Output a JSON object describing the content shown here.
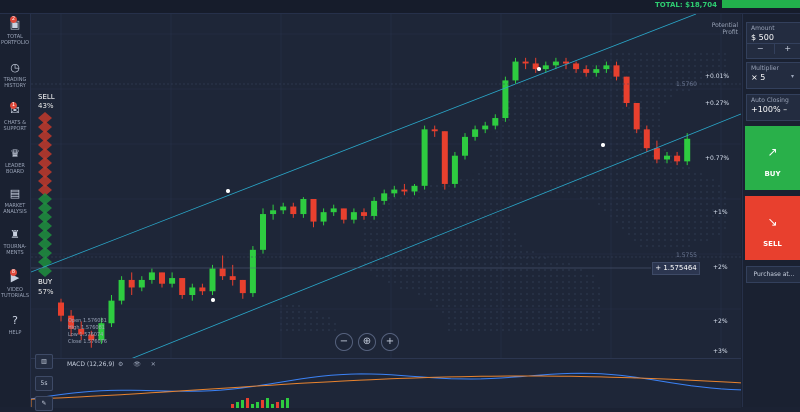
{
  "topbar": {
    "total": "TOTAL: $18,704"
  },
  "sidebar": {
    "items": [
      {
        "label": "TOTAL PORTFOLIO",
        "icon": "briefcase-icon",
        "glyph": "▣",
        "badge": "2"
      },
      {
        "label": "TRADING HISTORY",
        "icon": "history-icon",
        "glyph": "◷"
      },
      {
        "label": "CHATS & SUPPORT",
        "icon": "chat-icon",
        "glyph": "✉",
        "badge": "1"
      },
      {
        "label": "LEADER BOARD",
        "icon": "leaderboard-icon",
        "glyph": "♛"
      },
      {
        "label": "MARKET ANALYSIS",
        "icon": "market-analysis-icon",
        "glyph": "▤"
      },
      {
        "label": "TOURNA-MENTS",
        "icon": "trophy-icon",
        "glyph": "♜"
      },
      {
        "label": "VIDEO TUTORIALS",
        "icon": "video-icon",
        "glyph": "▶",
        "badge": "8"
      },
      {
        "label": "HELP",
        "icon": "help-icon",
        "glyph": "?"
      }
    ]
  },
  "sentiment": {
    "sell_label": "SELL",
    "sell_pct": "43%",
    "buy_label": "BUY",
    "buy_pct": "57%",
    "sell_color": "#c0392b",
    "buy_color": "#1e8f3e"
  },
  "potential_profit": "Potential Profit",
  "scale": {
    "labels": [
      "+0.01%",
      "+0.27%",
      "+0.77%",
      "+1%",
      "+2%",
      "+2%",
      "+3%"
    ],
    "price_upper": "1.5760",
    "price_lower": "1.5755",
    "current_price": "1.575464"
  },
  "ohlc": {
    "open": "Open 1.576081",
    "high": "High 1.576081",
    "low": "Low 1.576074",
    "close": "Close 1.576076"
  },
  "zoom": {
    "minus": "−",
    "center": "⊕",
    "plus": "+"
  },
  "indicator": {
    "label": "MACD (12,26,9)",
    "icons": "⚙ 👁 ✕"
  },
  "timeframe": {
    "chart_type": "▥",
    "interval": "5s",
    "drawing": "✎"
  },
  "right": {
    "amount_title": "Amount",
    "amount_value": "$ 500",
    "step_minus": "−",
    "step_plus": "+",
    "multiplier_title": "Multiplier",
    "multiplier_value": "× 5",
    "autoclose_title": "Auto Closing",
    "autoclose_value": "+100% –",
    "buy_label": "BUY",
    "sell_label": "SELL",
    "purchase_label": "Purchase at..."
  },
  "colors": {
    "up": "#2ecc40",
    "down": "#e8402e",
    "channel": "#2aa7c9",
    "bg": "#1e2638",
    "macd_line": "#3b82f6",
    "signal_line": "#e8832e"
  },
  "chart_data": {
    "type": "candlestick",
    "candles": [
      {
        "o": 1.5757,
        "h": 1.57572,
        "l": 1.5756,
        "c": 1.57563
      },
      {
        "o": 1.57563,
        "h": 1.57566,
        "l": 1.57552,
        "c": 1.57556
      },
      {
        "o": 1.57556,
        "h": 1.5756,
        "l": 1.5755,
        "c": 1.57553
      },
      {
        "o": 1.57553,
        "h": 1.57555,
        "l": 1.57546,
        "c": 1.5755
      },
      {
        "o": 1.5755,
        "h": 1.57562,
        "l": 1.57548,
        "c": 1.57559
      },
      {
        "o": 1.57559,
        "h": 1.57574,
        "l": 1.57557,
        "c": 1.57571
      },
      {
        "o": 1.57571,
        "h": 1.57584,
        "l": 1.57569,
        "c": 1.57582
      },
      {
        "o": 1.57582,
        "h": 1.57586,
        "l": 1.57574,
        "c": 1.57578
      },
      {
        "o": 1.57578,
        "h": 1.57584,
        "l": 1.57576,
        "c": 1.57582
      },
      {
        "o": 1.57582,
        "h": 1.57588,
        "l": 1.5758,
        "c": 1.57586
      },
      {
        "o": 1.57586,
        "h": 1.57586,
        "l": 1.57578,
        "c": 1.5758
      },
      {
        "o": 1.5758,
        "h": 1.57586,
        "l": 1.57578,
        "c": 1.57583
      },
      {
        "o": 1.57583,
        "h": 1.57583,
        "l": 1.57572,
        "c": 1.57574
      },
      {
        "o": 1.57574,
        "h": 1.5758,
        "l": 1.57571,
        "c": 1.57578
      },
      {
        "o": 1.57578,
        "h": 1.5758,
        "l": 1.57574,
        "c": 1.57576
      },
      {
        "o": 1.57576,
        "h": 1.5759,
        "l": 1.57574,
        "c": 1.57588
      },
      {
        "o": 1.57588,
        "h": 1.57595,
        "l": 1.57582,
        "c": 1.57584
      },
      {
        "o": 1.57584,
        "h": 1.5759,
        "l": 1.57579,
        "c": 1.57582
      },
      {
        "o": 1.57582,
        "h": 1.57582,
        "l": 1.57572,
        "c": 1.57575
      },
      {
        "o": 1.57575,
        "h": 1.576,
        "l": 1.57573,
        "c": 1.57598
      },
      {
        "o": 1.57598,
        "h": 1.5762,
        "l": 1.57596,
        "c": 1.57617
      },
      {
        "o": 1.57617,
        "h": 1.57622,
        "l": 1.57614,
        "c": 1.57619
      },
      {
        "o": 1.57619,
        "h": 1.57623,
        "l": 1.57617,
        "c": 1.57621
      },
      {
        "o": 1.57621,
        "h": 1.57623,
        "l": 1.57615,
        "c": 1.57617
      },
      {
        "o": 1.57617,
        "h": 1.57626,
        "l": 1.57615,
        "c": 1.57625
      },
      {
        "o": 1.57625,
        "h": 1.57625,
        "l": 1.5761,
        "c": 1.57613
      },
      {
        "o": 1.57613,
        "h": 1.5762,
        "l": 1.57611,
        "c": 1.57618
      },
      {
        "o": 1.57618,
        "h": 1.57622,
        "l": 1.57616,
        "c": 1.5762
      },
      {
        "o": 1.5762,
        "h": 1.5762,
        "l": 1.57612,
        "c": 1.57614
      },
      {
        "o": 1.57614,
        "h": 1.5762,
        "l": 1.57612,
        "c": 1.57618
      },
      {
        "o": 1.57618,
        "h": 1.5762,
        "l": 1.57614,
        "c": 1.57616
      },
      {
        "o": 1.57616,
        "h": 1.57626,
        "l": 1.57614,
        "c": 1.57624
      },
      {
        "o": 1.57624,
        "h": 1.5763,
        "l": 1.57622,
        "c": 1.57628
      },
      {
        "o": 1.57628,
        "h": 1.57632,
        "l": 1.57626,
        "c": 1.5763
      },
      {
        "o": 1.5763,
        "h": 1.57633,
        "l": 1.57627,
        "c": 1.57629
      },
      {
        "o": 1.57629,
        "h": 1.57633,
        "l": 1.57627,
        "c": 1.57632
      },
      {
        "o": 1.57632,
        "h": 1.57664,
        "l": 1.5763,
        "c": 1.57662
      },
      {
        "o": 1.57662,
        "h": 1.57664,
        "l": 1.57658,
        "c": 1.57661
      },
      {
        "o": 1.57661,
        "h": 1.57661,
        "l": 1.5763,
        "c": 1.57633
      },
      {
        "o": 1.57633,
        "h": 1.5765,
        "l": 1.57631,
        "c": 1.57648
      },
      {
        "o": 1.57648,
        "h": 1.5766,
        "l": 1.57646,
        "c": 1.57658
      },
      {
        "o": 1.57658,
        "h": 1.57664,
        "l": 1.57656,
        "c": 1.57662
      },
      {
        "o": 1.57662,
        "h": 1.57666,
        "l": 1.5766,
        "c": 1.57664
      },
      {
        "o": 1.57664,
        "h": 1.5767,
        "l": 1.57662,
        "c": 1.57668
      },
      {
        "o": 1.57668,
        "h": 1.5769,
        "l": 1.57666,
        "c": 1.57688
      },
      {
        "o": 1.57688,
        "h": 1.577,
        "l": 1.57686,
        "c": 1.57698
      },
      {
        "o": 1.57698,
        "h": 1.577,
        "l": 1.57694,
        "c": 1.57697
      },
      {
        "o": 1.57697,
        "h": 1.577,
        "l": 1.57692,
        "c": 1.57694
      },
      {
        "o": 1.57694,
        "h": 1.57698,
        "l": 1.57692,
        "c": 1.57696
      },
      {
        "o": 1.57696,
        "h": 1.577,
        "l": 1.57694,
        "c": 1.57698
      },
      {
        "o": 1.57698,
        "h": 1.577,
        "l": 1.57694,
        "c": 1.57697
      },
      {
        "o": 1.57697,
        "h": 1.57698,
        "l": 1.57692,
        "c": 1.57694
      },
      {
        "o": 1.57694,
        "h": 1.57696,
        "l": 1.5769,
        "c": 1.57692
      },
      {
        "o": 1.57692,
        "h": 1.57696,
        "l": 1.5769,
        "c": 1.57694
      },
      {
        "o": 1.57694,
        "h": 1.57698,
        "l": 1.57692,
        "c": 1.57696
      },
      {
        "o": 1.57696,
        "h": 1.57698,
        "l": 1.57688,
        "c": 1.5769
      },
      {
        "o": 1.5769,
        "h": 1.5769,
        "l": 1.57674,
        "c": 1.57676
      },
      {
        "o": 1.57676,
        "h": 1.57676,
        "l": 1.5766,
        "c": 1.57662
      },
      {
        "o": 1.57662,
        "h": 1.57664,
        "l": 1.5765,
        "c": 1.57652
      },
      {
        "o": 1.57652,
        "h": 1.57656,
        "l": 1.57644,
        "c": 1.57646
      },
      {
        "o": 1.57646,
        "h": 1.5765,
        "l": 1.57644,
        "c": 1.57648
      },
      {
        "o": 1.57648,
        "h": 1.5765,
        "l": 1.57643,
        "c": 1.57645
      },
      {
        "o": 1.57645,
        "h": 1.5766,
        "l": 1.57643,
        "c": 1.57657
      }
    ],
    "ylim": [
      1.5754,
      1.5771
    ]
  }
}
